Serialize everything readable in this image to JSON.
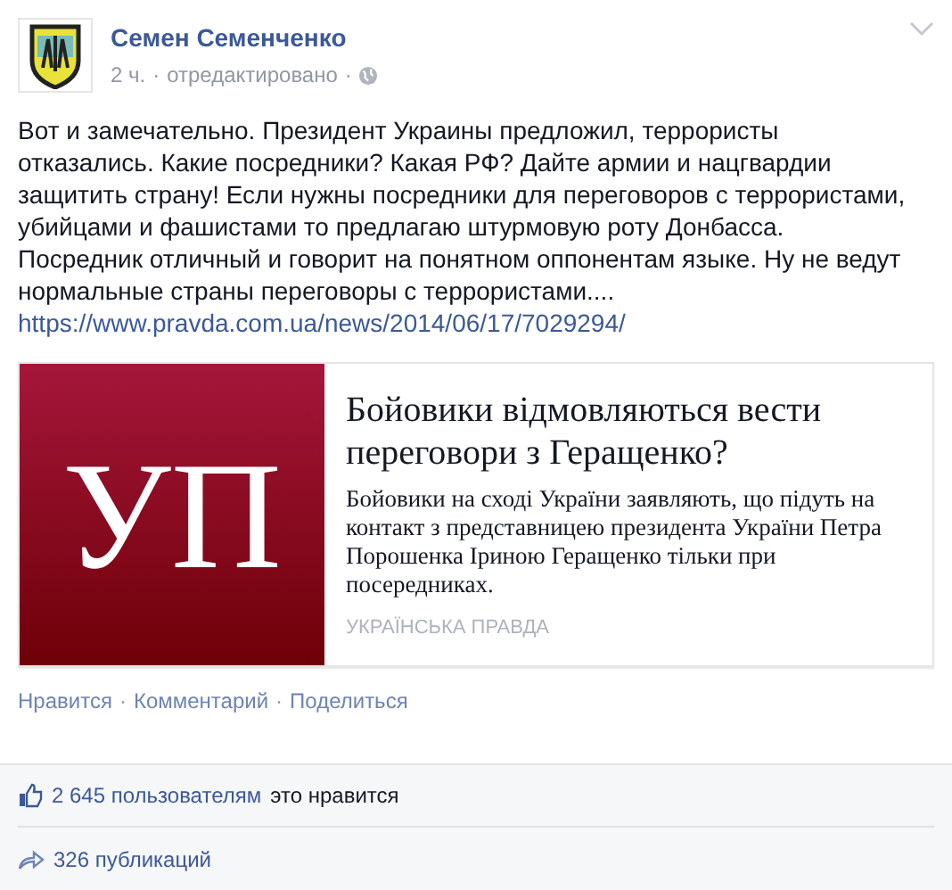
{
  "post": {
    "author": "Семен Семенченко",
    "time": "2 ч.",
    "edited": "отредактировано",
    "text": "Вот и замечательно. Президент Украины предложил, террористы отказались. Какие посредники? Какая РФ? Дайте армии и нацгвардии защитить страну! Если нужны посредники для переговоров с террористами, убийцами и фашистами то предлагаю штурмовую роту Донбасса. Посредник отличный и говорит на понятном оппонентам языке. Ну не ведут нормальные страны переговоры с террористами....",
    "link": "https://www.pravda.com.ua/news/2014/06/17/7029294/"
  },
  "link_card": {
    "thumbnail_text": "УП",
    "title": "Бойовики відмовляються вести переговори з Геращенко?",
    "summary": "Бойовики на сході України заявляють, що підуть на контакт з представницею президента України Петра Порошенка Іриною Геращенко тільки при посередниках.",
    "source": "УКРАЇНСЬКА ПРАВДА"
  },
  "actions": [
    "Нравится",
    "Комментарий",
    "Поделиться"
  ],
  "likes": {
    "count": "2 645 пользователям",
    "suffix": "это нравится"
  },
  "shares": "326 публикаций",
  "separator": "·"
}
